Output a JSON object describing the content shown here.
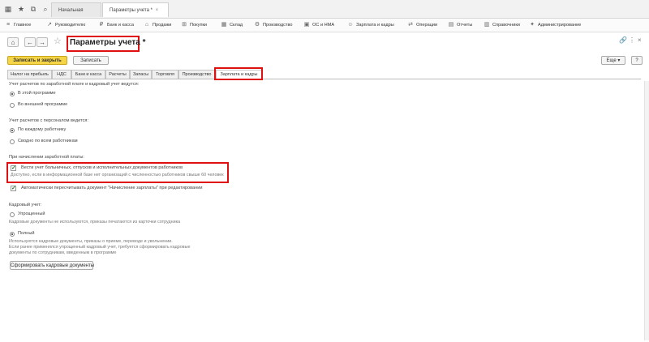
{
  "window_tabs": {
    "home": "Начальная страница",
    "current": "Параметры учета *",
    "close_symbol": "×"
  },
  "menu": [
    {
      "icon": "home-icon",
      "glyph": "≡",
      "label": "Главное"
    },
    {
      "icon": "chart-icon",
      "glyph": "↗",
      "label": "Руководителю"
    },
    {
      "icon": "bank-icon",
      "glyph": "₽",
      "label": "Банк и касса"
    },
    {
      "icon": "cart-icon",
      "glyph": "⌂",
      "label": "Продажи"
    },
    {
      "icon": "basket-icon",
      "glyph": "⊞",
      "label": "Покупки"
    },
    {
      "icon": "warehouse-icon",
      "glyph": "▦",
      "label": "Склад"
    },
    {
      "icon": "factory-icon",
      "glyph": "⚙",
      "label": "Производство"
    },
    {
      "icon": "assets-icon",
      "glyph": "▣",
      "label": "ОС и НМА"
    },
    {
      "icon": "people-icon",
      "glyph": "☺",
      "label": "Зарплата и кадры"
    },
    {
      "icon": "operations-icon",
      "glyph": "⇄",
      "label": "Операции"
    },
    {
      "icon": "reports-icon",
      "glyph": "▤",
      "label": "Отчеты"
    },
    {
      "icon": "directory-icon",
      "glyph": "▥",
      "label": "Справочники"
    },
    {
      "icon": "admin-icon",
      "glyph": "✦",
      "label": "Администрирование"
    }
  ],
  "form": {
    "title": "Параметры учета *",
    "save_close": "Записать и закрыть",
    "save": "Записать",
    "more": "Еще ▾",
    "help": "?"
  },
  "tabs": [
    {
      "label": "Налог на прибыль"
    },
    {
      "label": "НДС"
    },
    {
      "label": "Банк и касса"
    },
    {
      "label": "Расчеты"
    },
    {
      "label": "Запасы"
    },
    {
      "label": "Торговля"
    },
    {
      "label": "Производство"
    },
    {
      "label": "Зарплата и кадры"
    }
  ],
  "salary_section": {
    "heading": "Учет расчетов по заработной плате и кадровый учет ведутся:",
    "opt_this": "В этой программе",
    "opt_external": "Во внешней программе"
  },
  "personnel_section": {
    "heading": "Учет расчетов с персоналом ведется:",
    "opt_each": "По каждому работнику",
    "opt_summary": "Сводно по всем работникам"
  },
  "payroll_section": {
    "heading": "При начислении заработной платы:",
    "chk_sick": "Вести учет больничных, отпусков и исполнительных документов работников",
    "chk_sick_hint": "Доступно, если в информационной базе нет организаций с численностью работников свыше 60 человек",
    "chk_recalc": "Автоматически пересчитывать документ \"Начисление зарплаты\" при редактировании"
  },
  "hr_section": {
    "heading": "Кадровый учет:",
    "opt_simple": "Упрощенный",
    "opt_simple_hint": "Кадровые документы не используются, приказы печатаются из карточки сотрудника",
    "opt_full": "Полный",
    "opt_full_hint_1": "Используются кадровые документы, приказы о приеме, переводе и увольнении.",
    "opt_full_hint_2": "Если ранее применялся упрощенный кадровый учет, требуется сформировать кадровые",
    "opt_full_hint_3": "документы по сотрудникам, введенным в программе",
    "btn_generate": "Сформировать кадровые документы"
  },
  "colors": {
    "accent_yellow": "#f5d547",
    "highlight_red": "#e01010",
    "check_green": "#2a7a2a"
  }
}
